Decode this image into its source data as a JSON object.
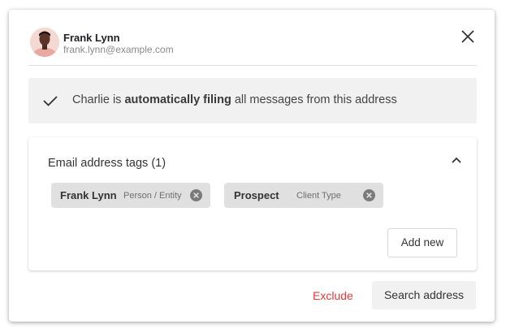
{
  "contact": {
    "name": "Frank Lynn",
    "email": "frank.lynn@example.com"
  },
  "banner": {
    "prefix": "Charlie is ",
    "emphasis": "automatically filing",
    "suffix": " all messages from this address"
  },
  "tags": {
    "title": "Email address tags (1)",
    "chips": [
      {
        "name": "Frank Lynn",
        "type": "Person / Entity"
      },
      {
        "name": "Prospect",
        "type": "Client Type"
      }
    ],
    "add_label": "Add new"
  },
  "footer": {
    "exclude_label": "Exclude",
    "search_label": "Search address"
  },
  "colors": {
    "danger": "#e53935",
    "chip_bg": "#e0e0e0",
    "banner_bg": "#f1f1f1"
  },
  "icons": [
    "close-icon",
    "check-icon",
    "chevron-up-icon",
    "remove-chip-icon"
  ]
}
